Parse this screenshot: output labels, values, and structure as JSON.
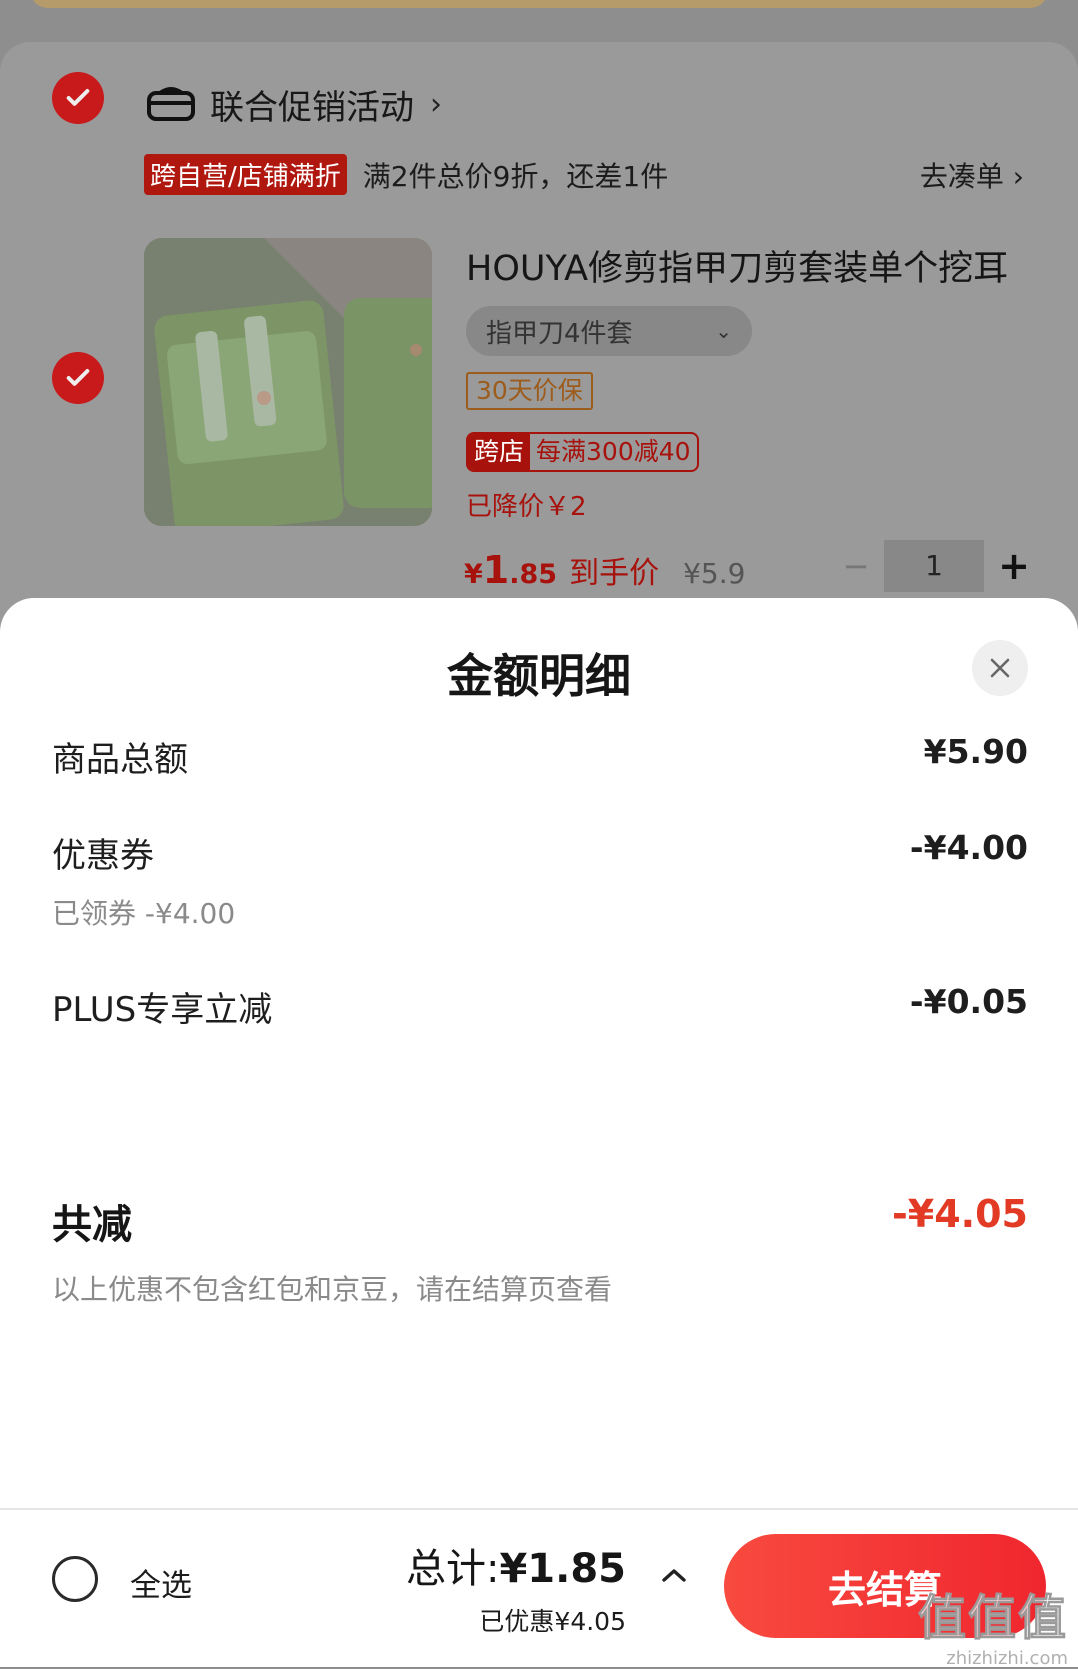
{
  "cart": {
    "promo_title": "联合促销活动",
    "rule_tag": "跨自营/店铺满折",
    "rule_text": "满2件总价9折，还差1件",
    "rule_link": "去凑单",
    "product": {
      "title": "HOUYA修剪指甲刀剪套装单个挖耳",
      "sku": "指甲刀4件套",
      "price_protect": "30天价保",
      "store_tag_a": "跨店",
      "store_tag_b": "每满300减40",
      "price_drop": "已降价￥2",
      "price_symbol": "¥",
      "price_int": "1",
      "price_dec": ".85",
      "to_hand": "到手价",
      "orig_price": "¥5.9",
      "qty": "1"
    }
  },
  "sheet": {
    "title": "金额明细",
    "rows": [
      {
        "label": "商品总额",
        "value": "¥5.90"
      },
      {
        "label": "优惠券",
        "value": "-¥4.00",
        "sub": "已领券 -¥4.00"
      },
      {
        "label": "PLUS专享立减",
        "value": "-¥0.05"
      }
    ],
    "total_label": "共减",
    "total_value": "-¥4.05",
    "note": "以上优惠不包含红包和京豆，请在结算页查看"
  },
  "bottom": {
    "select_all": "全选",
    "total_label": "总计:",
    "total_value": "¥1.85",
    "saved": "已优惠¥4.05",
    "checkout": "去结算"
  },
  "watermark": {
    "big": "值值值",
    "small": "zhizhizhi.com"
  },
  "colors": {
    "accent_red": "#e23a24",
    "checkout_red": "#f0262e"
  }
}
